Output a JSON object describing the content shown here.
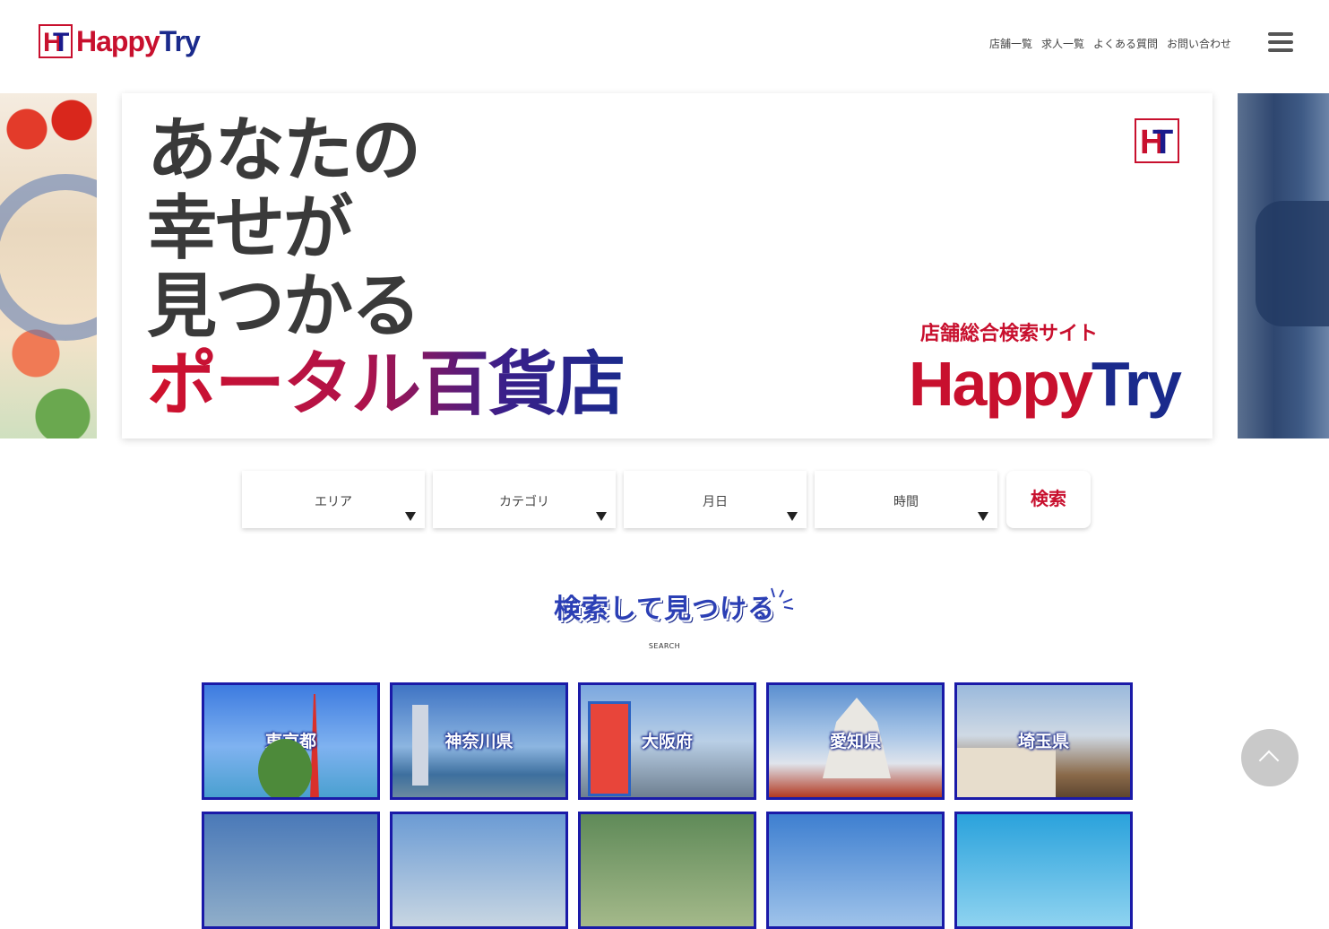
{
  "header": {
    "logo": {
      "mark_h": "H",
      "mark_t": "T",
      "text_a": "Happy",
      "text_b": "Try"
    },
    "nav": [
      "店舗一覧",
      "求人一覧",
      "よくある質問",
      "お問い合わせ"
    ]
  },
  "hero": {
    "catch_lines": [
      "あなたの",
      "幸せが",
      "見つかる",
      "ポータル百貨店"
    ],
    "subtitle": "店舗総合検索サイト",
    "brand_a": "Happy",
    "brand_b": "Try"
  },
  "search": {
    "selects": [
      "エリア",
      "カテゴリ",
      "月日",
      "時間"
    ],
    "button": "検索"
  },
  "section": {
    "title": "検索して見つける",
    "subtitle": "SEARCH"
  },
  "prefectures": [
    "東京都",
    "神奈川県",
    "大阪府",
    "愛知県",
    "埼玉県"
  ],
  "colors": {
    "accent_red": "#c8102e",
    "accent_blue": "#1a2a8c",
    "tile_border": "#1a1aa8"
  }
}
